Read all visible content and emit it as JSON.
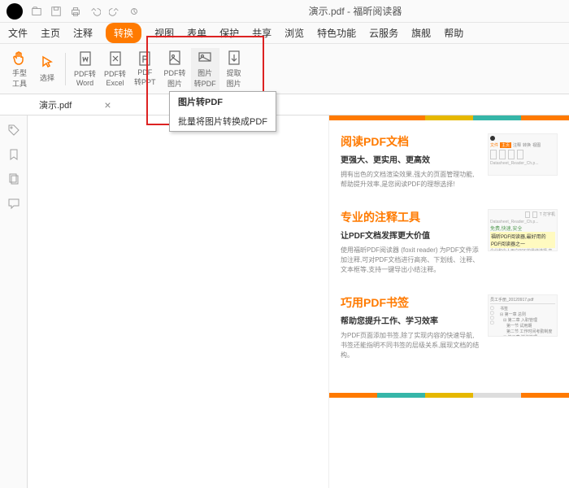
{
  "titlebar": {
    "title": "演示.pdf - 福昕阅读器"
  },
  "menubar": {
    "items": [
      "文件",
      "主页",
      "注释",
      "转换",
      "视图",
      "表单",
      "保护",
      "共享",
      "浏览",
      "特色功能",
      "云服务",
      "旗舰",
      "帮助"
    ],
    "active_index": 3
  },
  "toolbar": {
    "hand": "手型\n工具",
    "select": "选择",
    "pdf_word": "PDF转\nWord",
    "pdf_excel": "PDF转\nExcel",
    "pdf_ppt": "PDF\n转PPT",
    "pdf_img": "PDF转\n图片",
    "img_pdf": "图片\n转PDF",
    "extract_img": "提取\n图片"
  },
  "dropdown": {
    "title": "图片转PDF",
    "desc": "批量将图片转换成PDF"
  },
  "tab": {
    "name": "演示.pdf"
  },
  "doc": {
    "border_colors": [
      "#ff7a00",
      "#ff7a00",
      "#e6b800",
      "#36b6a8",
      "#ff7a00"
    ],
    "section1": {
      "title": "阅读PDF文档",
      "subtitle": "更强大、更实用、更高效",
      "body": "拥有出色的文档渲染效果,强大的页面管理功能,帮助提升效率,是您阅读PDF的理想选择!"
    },
    "section2": {
      "title": "专业的注释工具",
      "subtitle": "让PDF文档发挥更大价值",
      "body": "使用福昕PDF阅读器 (foxit reader) 为PDF文件添加注释,可对PDF文档进行高亮、下划线、注释、文本框等,支持一键导出小结注释。",
      "thumb_green": "免费,快速,安全"
    },
    "section3": {
      "title": "巧用PDF书签",
      "subtitle": "帮助您提升工作、学习效率",
      "body": "为PDF页面添加书签,除了实现内容的快速导航,书签还能指明不同书签的层级关系,展现文档的结构。",
      "thumb_file": "员工手册_20120917.pdf",
      "thumb_label": "书签"
    }
  }
}
